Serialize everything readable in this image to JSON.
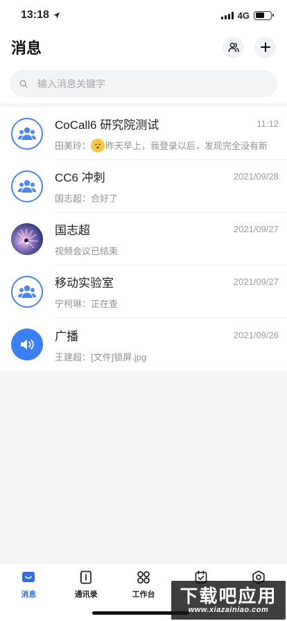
{
  "status_bar": {
    "time": "13:18",
    "network": "4G",
    "battery_level": 0.6
  },
  "header": {
    "title": "消息"
  },
  "search": {
    "placeholder": "输入消息关键字"
  },
  "conversations": [
    {
      "name": "CoCall6 研究院测试",
      "time": "11:12",
      "sender": "田美玲：",
      "message": "昨天早上，我登录以后，发现完全没有新",
      "avatar": "group-icon"
    },
    {
      "name": "CC6 冲刺",
      "time": "2021/09/28",
      "sender": "国志超：",
      "message": "合好了",
      "avatar": "group-icon"
    },
    {
      "name": "国志超",
      "time": "2021/09/27",
      "sender": "",
      "message": "视频会议已结束",
      "avatar": "photo"
    },
    {
      "name": "移动实验室",
      "time": "2021/09/27",
      "sender": "宁柯琳：",
      "message": "正在查",
      "avatar": "group-icon"
    },
    {
      "name": "广播",
      "time": "2021/09/26",
      "sender": "王建超：",
      "message": "[文件]锁屏.jpg",
      "avatar": "speaker-icon"
    }
  ],
  "tabbar": {
    "messages": "消息",
    "contacts": "通讯录",
    "workbench": "工作台"
  },
  "watermark": {
    "main": "下载吧应用",
    "sub": "www.xiazainiao.com"
  },
  "colors": {
    "accent": "#2f6fe0",
    "group_ring": "#4b86f0",
    "broadcast": "#3a7ff3"
  }
}
